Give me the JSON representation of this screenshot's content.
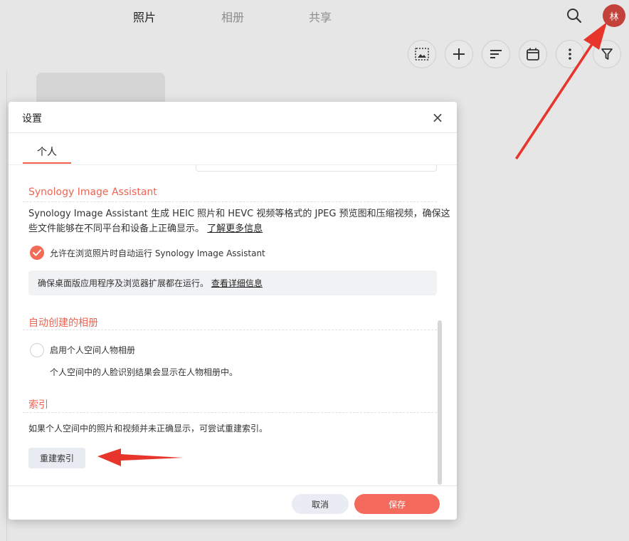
{
  "nav": {
    "tabs": [
      {
        "label": "照片"
      },
      {
        "label": "相册"
      },
      {
        "label": "共享"
      }
    ],
    "avatar_initial": "林"
  },
  "toolbar": {
    "buttons": [
      "select-photo-icon",
      "add-icon",
      "sort-icon",
      "calendar-icon",
      "more-icon",
      "filter-icon"
    ]
  },
  "modal": {
    "title": "设置",
    "close": "×",
    "tab_label": "个人",
    "assistant": {
      "title": "Synology Image Assistant",
      "desc_1": "Synology Image Assistant 生成 HEIC 照片和 HEVC 视频等格式的 JPEG 预览图和压缩视频，确保这",
      "desc_2": "些文件能够在不同平台和设备上正确显示。",
      "learn_more": "了解更多信息",
      "checkbox_label": "允许在浏览照片时自动运行 Synology Image Assistant",
      "checked": true,
      "info_text": "确保桌面版应用程序及浏览器扩展都在运行。",
      "info_link": "查看详细信息"
    },
    "auto_album": {
      "title": "自动创建的相册",
      "radio_label": "启用个人空间人物相册",
      "checked": false,
      "radio_desc": "个人空间中的人脸识别结果会显示在人物相册中。"
    },
    "index": {
      "title": "索引",
      "desc": "如果个人空间中的照片和视频并未正确显示，可尝试重建索引。",
      "button": "重建索引"
    },
    "footer": {
      "cancel": "取消",
      "save": "保存"
    }
  },
  "colors": {
    "accent": "#f26b57",
    "avatar": "#c2413a",
    "annotation_arrow": "#e8352b"
  }
}
